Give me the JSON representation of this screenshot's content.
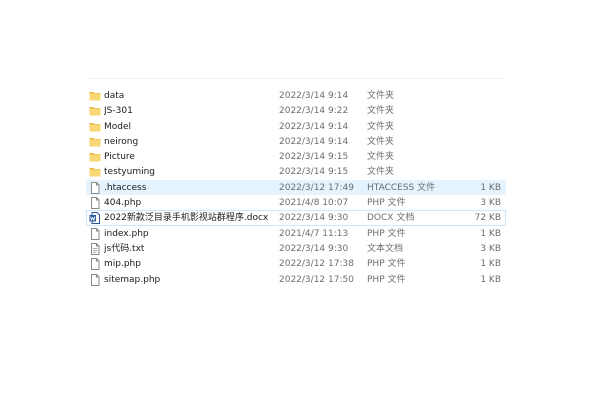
{
  "colors": {
    "folder": "#f8d775",
    "folder_dark": "#e8b73f",
    "hover_bg": "#e5f3ff",
    "focus_border": "#cce8ff",
    "docx_blue": "#2b579a",
    "secondary_text": "#6d6d6d"
  },
  "files": [
    {
      "name": "data",
      "date": "2022/3/14 9:14",
      "type": "文件夹",
      "size": "",
      "icon": "folder-icon"
    },
    {
      "name": "JS-301",
      "date": "2022/3/14 9:22",
      "type": "文件夹",
      "size": "",
      "icon": "folder-icon"
    },
    {
      "name": "Model",
      "date": "2022/3/14 9:14",
      "type": "文件夹",
      "size": "",
      "icon": "folder-icon"
    },
    {
      "name": "neirong",
      "date": "2022/3/14 9:14",
      "type": "文件夹",
      "size": "",
      "icon": "folder-icon"
    },
    {
      "name": "Picture",
      "date": "2022/3/14 9:15",
      "type": "文件夹",
      "size": "",
      "icon": "folder-icon"
    },
    {
      "name": "testyuming",
      "date": "2022/3/14 9:15",
      "type": "文件夹",
      "size": "",
      "icon": "folder-icon"
    },
    {
      "name": ".htaccess",
      "date": "2022/3/12 17:49",
      "type": "HTACCESS 文件",
      "size": "1 KB",
      "icon": "file-icon"
    },
    {
      "name": "404.php",
      "date": "2021/4/8 10:07",
      "type": "PHP 文件",
      "size": "3 KB",
      "icon": "file-icon"
    },
    {
      "name": "2022新款泛目录手机影视站群程序.docx",
      "date": "2022/3/14 9:30",
      "type": "DOCX 文档",
      "size": "72 KB",
      "icon": "docx-icon"
    },
    {
      "name": "index.php",
      "date": "2021/4/7 11:13",
      "type": "PHP 文件",
      "size": "1 KB",
      "icon": "file-icon"
    },
    {
      "name": "js代码.txt",
      "date": "2022/3/14 9:30",
      "type": "文本文档",
      "size": "3 KB",
      "icon": "text-file-icon"
    },
    {
      "name": "mip.php",
      "date": "2022/3/12 17:38",
      "type": "PHP 文件",
      "size": "1 KB",
      "icon": "file-icon"
    },
    {
      "name": "sitemap.php",
      "date": "2022/3/12 17:50",
      "type": "PHP 文件",
      "size": "1 KB",
      "icon": "file-icon"
    }
  ]
}
